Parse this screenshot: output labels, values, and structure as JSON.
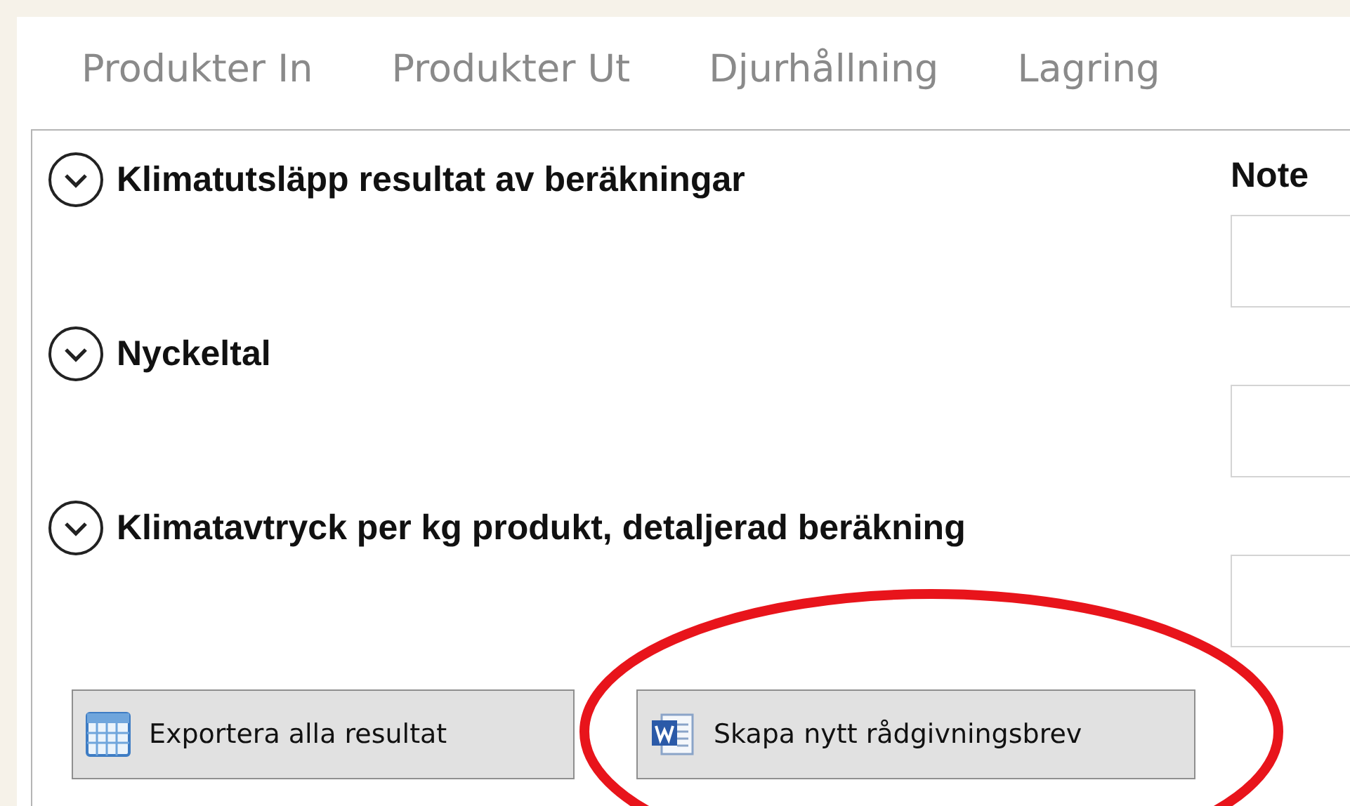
{
  "tabs": [
    {
      "label": "Produkter In",
      "selected": false
    },
    {
      "label": "Produkter Ut",
      "selected": false
    },
    {
      "label": "Djurhållning",
      "selected": false
    },
    {
      "label": "Lagring",
      "selected": false
    }
  ],
  "sections": [
    {
      "title": "Klimatutsläpp resultat av beräkningar",
      "expanded": false
    },
    {
      "title": "Nyckeltal",
      "expanded": false
    },
    {
      "title": "Klimatavtryck per kg produkt, detaljerad beräkning",
      "expanded": false
    }
  ],
  "notes": {
    "label": "Note",
    "fields": [
      {
        "disabled": false
      },
      {
        "disabled": false
      },
      {
        "disabled": false
      }
    ]
  },
  "buttons": [
    {
      "kind": "spreadsheet",
      "label": "Exportera alla resultat"
    },
    {
      "kind": "document",
      "label": "Skapa nytt rådgivningsbrev"
    }
  ]
}
